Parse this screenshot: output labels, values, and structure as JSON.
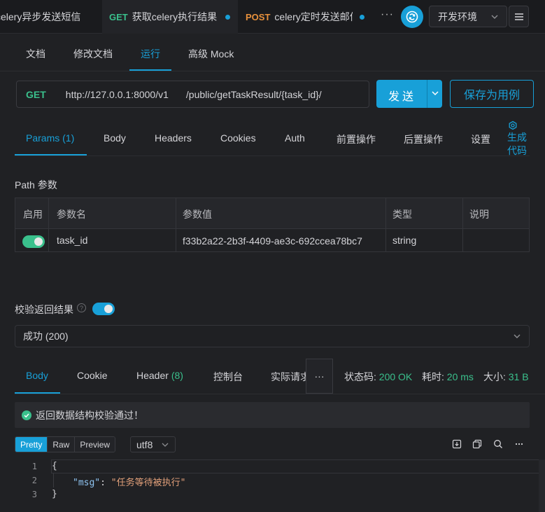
{
  "tabs": [
    {
      "method": "",
      "title": "celery异步发送短信"
    },
    {
      "method": "GET",
      "title": "获取celery执行结果"
    },
    {
      "method": "POST",
      "title": "celery定时发送邮件"
    }
  ],
  "tab_more": "···",
  "environment": "开发环境",
  "subtabs": [
    "文档",
    "修改文档",
    "运行",
    "高级 Mock"
  ],
  "url": {
    "method": "GET",
    "base": "http://127.0.0.1:8000/v1",
    "path": "/public/getTaskResult/{task_id}/"
  },
  "send_label": "发送",
  "save_label": "保存为用例",
  "param_tabs": [
    "Params (1)",
    "Body",
    "Headers",
    "Cookies",
    "Auth",
    "前置操作",
    "后置操作",
    "设置"
  ],
  "gen_code": {
    "line1": "生成",
    "line2": "代码"
  },
  "path_section_title": "Path 参数",
  "params_table": {
    "headers": [
      "启用",
      "参数名",
      "参数值",
      "类型",
      "说明"
    ],
    "rows": [
      {
        "enabled": true,
        "name": "task_id",
        "value": "f33b2a22-2b3f-4409-ae3c-692ccea78bc7",
        "type": "string",
        "desc": ""
      }
    ]
  },
  "validate_label": "校验返回结果",
  "validate_enabled": true,
  "status_option": "成功 (200)",
  "response_tabs": [
    "Body",
    "Cookie",
    "Header (8)",
    "控制台",
    "实际请求"
  ],
  "response_more": "···",
  "response_stats": {
    "status_label": "状态码:",
    "status_value": "200 OK",
    "time_label": "耗时:",
    "time_value": "20 ms",
    "size_label": "大小:",
    "size_value": "31 B"
  },
  "validation_message": "返回数据结构校验通过！",
  "format_buttons": [
    "Pretty",
    "Raw",
    "Preview"
  ],
  "encoding": "utf8",
  "code_lines": {
    "l1": "{",
    "key": "\"msg\"",
    "colon": ": ",
    "val": "\"任务等待被执行\"",
    "l3": "}"
  },
  "line_numbers": [
    "1",
    "2",
    "3"
  ],
  "colors": {
    "accent": "#18a0d8",
    "success": "#3ac08c",
    "post": "#e8913c"
  }
}
